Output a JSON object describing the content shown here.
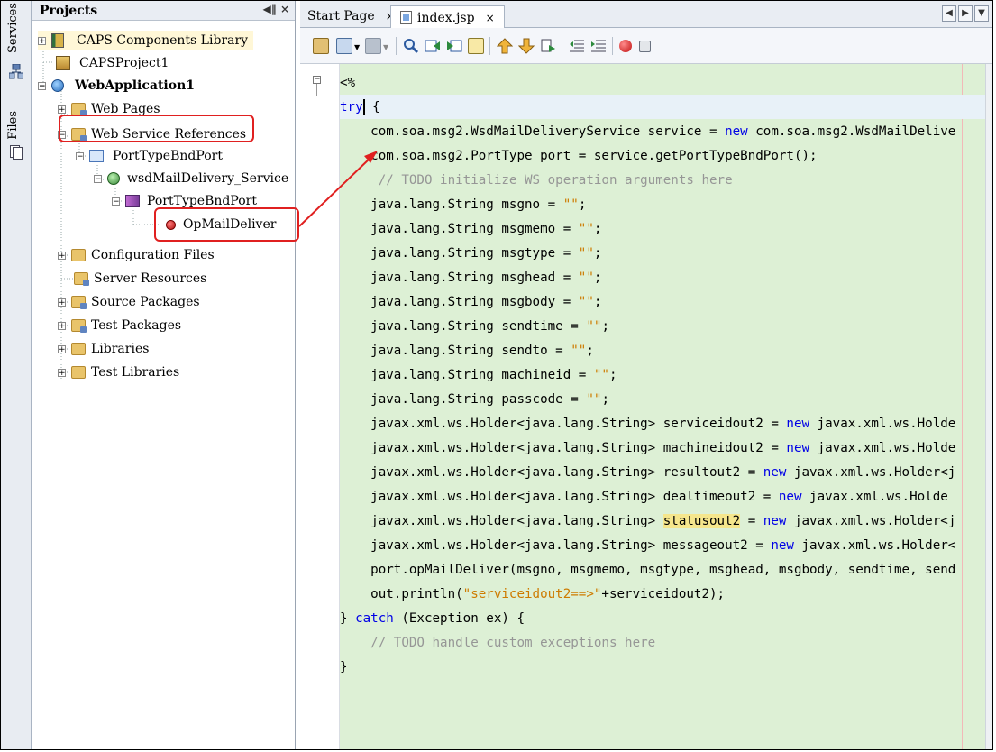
{
  "sidebar_tabs": {
    "services": "Services",
    "files": "Files"
  },
  "projects": {
    "title": "Projects",
    "controls": "◀‖ ×",
    "tree": [
      {
        "label": "CAPS Components Library",
        "icon": "library-icon"
      },
      {
        "label": "CAPSProject1",
        "icon": "caps-project-icon"
      },
      {
        "label": "WebApplication1",
        "icon": "web-application-icon"
      },
      {
        "label": "Web Pages",
        "icon": "folder-icon"
      },
      {
        "label": "Web Service References",
        "icon": "folder-icon"
      },
      {
        "label": "PortTypeBndPort",
        "icon": "service-icon"
      },
      {
        "label": "wsdMailDelivery_Service",
        "icon": "wsdl-service-icon"
      },
      {
        "label": "PortTypeBndPort",
        "icon": "port-icon"
      },
      {
        "label": "OpMailDeliver",
        "icon": "operation-icon"
      },
      {
        "label": "Configuration Files",
        "icon": "folder-icon"
      },
      {
        "label": "Server Resources",
        "icon": "folder-icon"
      },
      {
        "label": "Source Packages",
        "icon": "folder-icon"
      },
      {
        "label": "Test Packages",
        "icon": "folder-icon"
      },
      {
        "label": "Libraries",
        "icon": "folder-icon"
      },
      {
        "label": "Test Libraries",
        "icon": "folder-icon"
      }
    ]
  },
  "editor": {
    "tabs": [
      {
        "label": "Start Page",
        "close": "×"
      },
      {
        "label": "index.jsp",
        "close": "×"
      }
    ],
    "nav_buttons": [
      "◀",
      "▶",
      "▼"
    ],
    "code": {
      "l0": "<%",
      "l1_kw": "try",
      "l1_rest": " {",
      "l2a": "    com.soa.msg2.WsdMailDeliveryService service = ",
      "l2_kw": "new",
      "l2b": " com.soa.msg2.WsdMailDelive",
      "l3": "    com.soa.msg2.PortType port = service.getPortTypeBndPort();",
      "l4": "     // TODO initialize WS operation arguments here",
      "l5a": "    java.lang.String msgno = ",
      "l6a": "    java.lang.String msgmemo = ",
      "l7a": "    java.lang.String msgtype = ",
      "l8a": "    java.lang.String msghead = ",
      "l9a": "    java.lang.String msgbody = ",
      "l10a": "    java.lang.String sendtime = ",
      "l11a": "    java.lang.String sendto = ",
      "l12a": "    java.lang.String machineid = ",
      "l13a": "    java.lang.String passcode = ",
      "empty_str": "\"\"",
      "semi": ";",
      "l14a": "    javax.xml.ws.Holder<java.lang.String> serviceidout2 = ",
      "l14b": " javax.xml.ws.Holde",
      "l15a": "    javax.xml.ws.Holder<java.lang.String> machineidout2 = ",
      "l15b": " javax.xml.ws.Holde",
      "l16a": "    javax.xml.ws.Holder<java.lang.String> resultout2 = ",
      "l16b": " javax.xml.ws.Holder<j",
      "l17a": "    javax.xml.ws.Holder<java.lang.String> dealtimeout2 = ",
      "l17b": " javax.xml.ws.Holde",
      "l18a": "    javax.xml.ws.Holder<java.lang.String> ",
      "l18_hl": "statusout2",
      "l18b": " = ",
      "l18c": " javax.xml.ws.Holder<j",
      "l19a": "    javax.xml.ws.Holder<java.lang.String> messageout2 = ",
      "l19b": " javax.xml.ws.Holder<",
      "l20": "    port.opMailDeliver(msgno, msgmemo, msgtype, msghead, msgbody, sendtime, send",
      "l21a": "    out.println(",
      "l21_str": "\"serviceidout2==>\"",
      "l21b": "+serviceidout2);",
      "l22a": "} ",
      "l22_kw": "catch",
      "l22b": " (Exception ex) {",
      "l23": "    // TODO handle custom exceptions here",
      "l24": "}"
    }
  },
  "colors": {
    "code_bg": "#ddf0d5",
    "keyword": "#0000e6",
    "string": "#ce7b00",
    "annotation": "#e02020"
  }
}
